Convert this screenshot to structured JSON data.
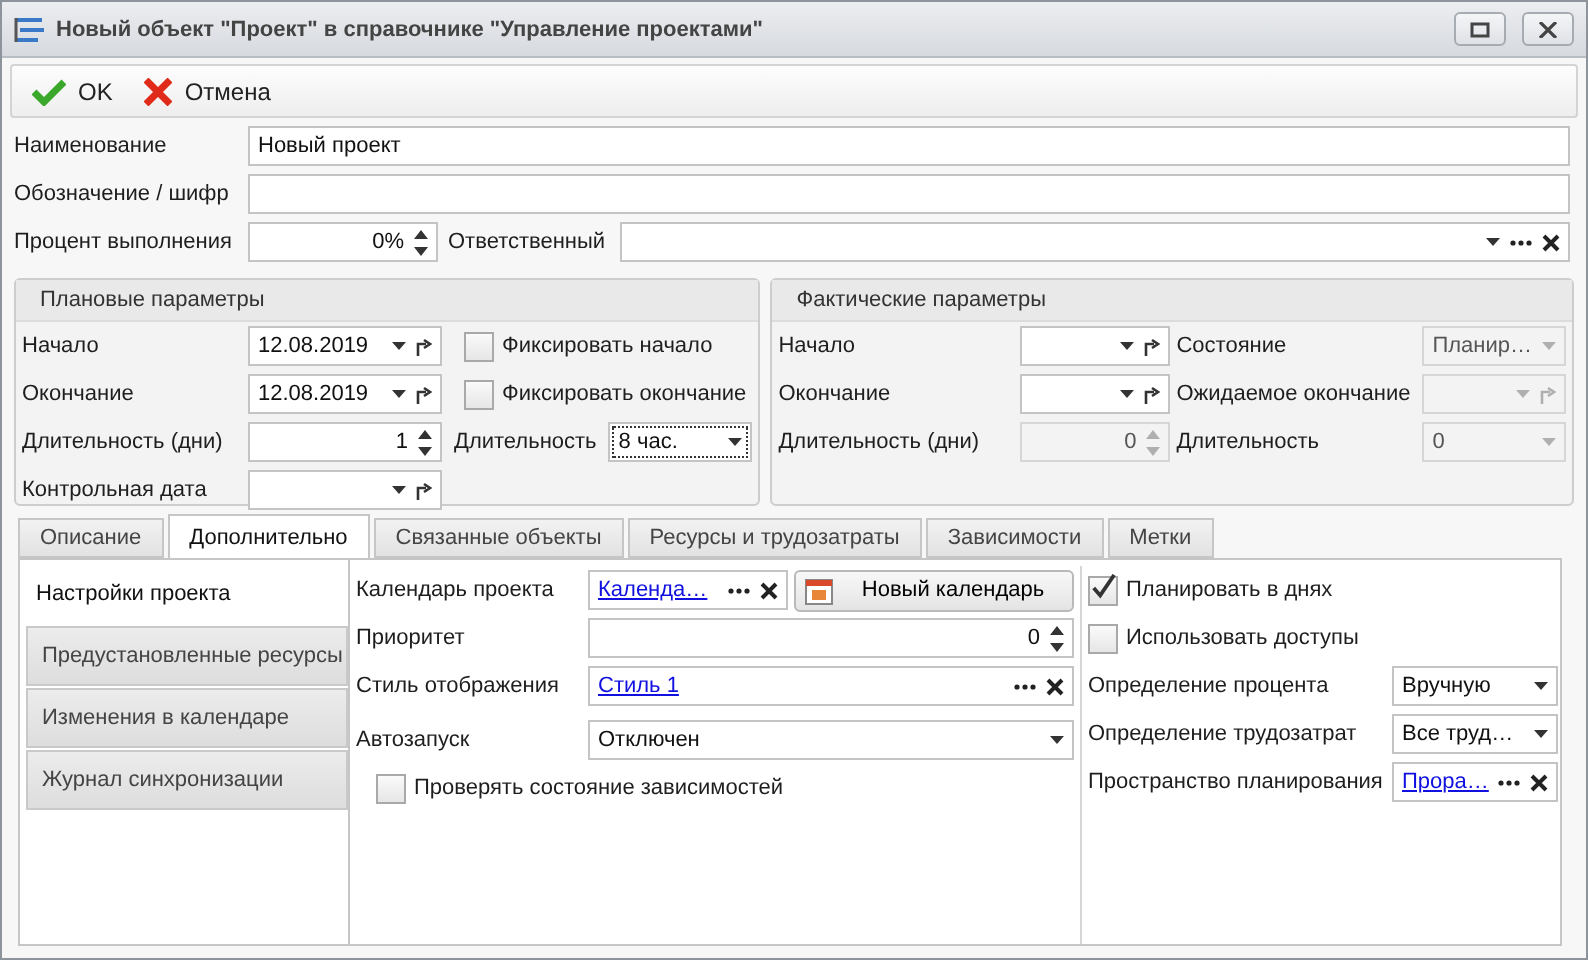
{
  "window": {
    "title": "Новый объект \"Проект\" в справочнике \"Управление проектами\""
  },
  "toolbar": [
    {
      "kind": "ok",
      "label": "OK"
    },
    {
      "kind": "cancel",
      "label": "Отмена"
    }
  ],
  "name": {
    "label": "Наименование",
    "value": "Новый проект"
  },
  "code": {
    "label": "Обозначение / шифр"
  },
  "percent": {
    "label": "Процент выполнения",
    "value": "0%"
  },
  "responsible": {
    "label": "Ответственный"
  },
  "plan": {
    "title": "Плановые параметры",
    "start": {
      "label": "Начало",
      "value": "12.08.2019"
    },
    "fix_start": {
      "label": "Фиксировать начало",
      "checked": false
    },
    "end": {
      "label": "Окончание",
      "value": "12.08.2019"
    },
    "fix_end": {
      "label": "Фиксировать окончание",
      "checked": false
    },
    "duration_days": {
      "label": "Длительность (дни)",
      "value": "1"
    },
    "duration": {
      "label": "Длительность",
      "value": "8 час."
    },
    "control_date": {
      "label": "Контрольная дата"
    }
  },
  "fact": {
    "title": "Фактические параметры",
    "start": {
      "label": "Начало",
      "disabled": false
    },
    "state": {
      "label": "Состояние",
      "value": "Планир…",
      "disabled": true
    },
    "end": {
      "label": "Окончание",
      "disabled": false
    },
    "expected_end": {
      "label": "Ожидаемое окончание",
      "disabled": true
    },
    "duration_days": {
      "label": "Длительность (дни)",
      "value": "0",
      "disabled": true
    },
    "duration": {
      "label": "Длительность",
      "value": "0",
      "disabled": true
    }
  },
  "tabs": [
    {
      "label": "Описание",
      "selected": false
    },
    {
      "label": "Дополнительно",
      "selected": true
    },
    {
      "label": "Связанные объекты",
      "selected": false
    },
    {
      "label": "Ресурсы и трудозатраты",
      "selected": false
    },
    {
      "label": "Зависимости",
      "selected": false
    },
    {
      "label": "Метки",
      "selected": false
    }
  ],
  "side_tabs": [
    {
      "label": "Настройки проекта",
      "selected": true
    },
    {
      "label": "Предустановленные ресурсы",
      "selected": false
    },
    {
      "label": "Изменения в календаре",
      "selected": false
    },
    {
      "label": "Журнал синхронизации",
      "selected": false
    }
  ],
  "settings": {
    "calendar": {
      "label": "Календарь проекта",
      "value": "Календа…"
    },
    "new_calendar": {
      "label": "Новый календарь"
    },
    "priority": {
      "label": "Приоритет",
      "value": "0"
    },
    "style": {
      "label": "Стиль отображения",
      "value": "Стиль 1"
    },
    "autostart": {
      "label": "Автозапуск",
      "value": "Отключен"
    },
    "check_deps": {
      "label": "Проверять состояние зависимостей",
      "checked": false
    },
    "plan_days": {
      "label": "Планировать в днях",
      "checked": true
    },
    "use_access": {
      "label": "Использовать доступы",
      "checked": false
    },
    "percent_def": {
      "label": "Определение процента",
      "value": "Вручную"
    },
    "labor_def": {
      "label": "Определение трудозатрат",
      "value": "Все труд…"
    },
    "space": {
      "label": "Пространство планирования",
      "value": "Прора…"
    }
  }
}
